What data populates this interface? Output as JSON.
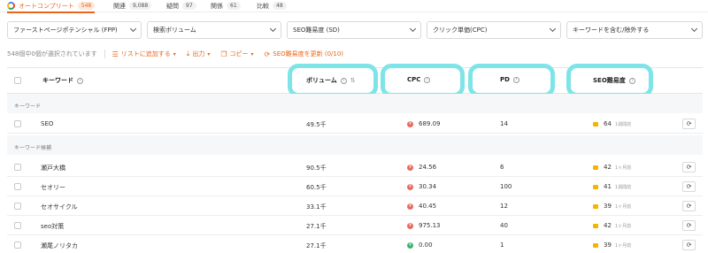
{
  "tabs": [
    {
      "label": "オートコンプリート",
      "count": "548",
      "active": true
    },
    {
      "label": "関連",
      "count": "9,088"
    },
    {
      "label": "疑問",
      "count": "97"
    },
    {
      "label": "関係",
      "count": "61"
    },
    {
      "label": "比較",
      "count": "48"
    }
  ],
  "filters": [
    {
      "label": "ファーストページポテンシャル (FPP)"
    },
    {
      "label": "検索ボリューム"
    },
    {
      "label": "SEO難易度 (SD)"
    },
    {
      "label": "クリック単価(CPC)"
    },
    {
      "label": "キーワードを含む/除外する"
    }
  ],
  "actions": {
    "selected_text": "548個中0個が選択されています",
    "add_to_list": "リストに追加する",
    "export": "出力",
    "copy": "コピー",
    "update_sd": "SEO難易度を更新 (0/10)"
  },
  "columns": {
    "keyword": "キーワード",
    "volume": "ボリューム",
    "cpc": "CPC",
    "pd": "PD",
    "sd": "SEO難易度"
  },
  "sections": {
    "keyword": "キーワード",
    "candidates": "キーワード候補"
  },
  "rows": [
    {
      "keyword": "SEO",
      "volume": "49.5千",
      "cpc": "689.09",
      "cpc_color": "#e86a5f",
      "pd": "14",
      "sd": "64",
      "sd_when": "1週間前"
    },
    {
      "keyword": "瀬戸大橋",
      "volume": "90.5千",
      "cpc": "24.56",
      "cpc_color": "#e86a5f",
      "pd": "6",
      "sd": "42",
      "sd_when": "1ヶ月前"
    },
    {
      "keyword": "セオリー",
      "volume": "60.5千",
      "cpc": "30.34",
      "cpc_color": "#e86a5f",
      "pd": "100",
      "sd": "41",
      "sd_when": "1週間前"
    },
    {
      "keyword": "セオサイクル",
      "volume": "33.1千",
      "cpc": "40.45",
      "cpc_color": "#e86a5f",
      "pd": "12",
      "sd": "39",
      "sd_when": "1ヶ月前"
    },
    {
      "keyword": "seo対策",
      "volume": "27.1千",
      "cpc": "975.13",
      "cpc_color": "#e86a5f",
      "pd": "40",
      "sd": "42",
      "sd_when": "1ヶ月前"
    },
    {
      "keyword": "瀬尾ノリタカ",
      "volume": "27.1千",
      "cpc": "0.00",
      "cpc_color": "#3cb371",
      "pd": "1",
      "sd": "39",
      "sd_when": "1ヶ月前"
    }
  ],
  "colors": {
    "accent": "#e8651a",
    "highlight": "#7ee4e8",
    "sd_bar": "#f5b400"
  },
  "icons": {
    "google": "google-icon",
    "add": "list-add-icon",
    "export": "download-icon",
    "copy": "copy-icon",
    "refresh": "refresh-icon"
  }
}
